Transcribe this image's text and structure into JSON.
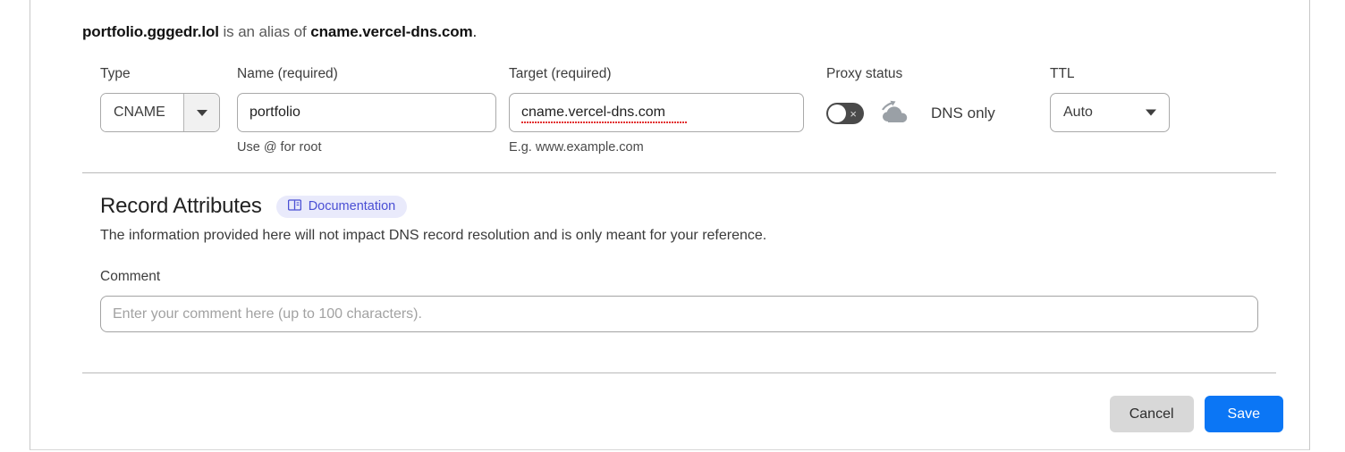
{
  "header": {
    "record_name": "portfolio.gggedr.lol",
    "middle_text": " is an alias of ",
    "target_name": "cname.vercel-dns.com",
    "period": "."
  },
  "form": {
    "type": {
      "label": "Type",
      "value": "CNAME",
      "icon": "chevron-down-icon"
    },
    "name": {
      "label": "Name (required)",
      "value": "portfolio",
      "placeholder": "",
      "hint": "Use @ for root"
    },
    "target": {
      "label": "Target (required)",
      "value": "cname.vercel-dns.com",
      "placeholder": "",
      "hint": "E.g. www.example.com"
    },
    "proxy": {
      "label": "Proxy status",
      "state_text": "DNS only",
      "toggle_state": "off",
      "toggle_mark": "×",
      "cloud_icon": "dns-only-cloud-icon"
    },
    "ttl": {
      "label": "TTL",
      "value": "Auto",
      "icon": "chevron-down-icon"
    }
  },
  "record_attributes": {
    "title": "Record Attributes",
    "badge": {
      "label": "Documentation",
      "icon": "book-icon"
    },
    "description": "The information provided here will not impact DNS record resolution and is only meant for your reference.",
    "comment": {
      "label": "Comment",
      "value": "",
      "placeholder": "Enter your comment here (up to 100 characters)."
    }
  },
  "actions": {
    "cancel_label": "Cancel",
    "save_label": "Save"
  },
  "colors": {
    "save_blue": "#0b76f5",
    "cancel_gray": "#d8d8d8",
    "badge_bg": "#e9eafb",
    "badge_text": "#4a4fd4",
    "toggle_off": "#4a4a4a",
    "cloud_gray": "#9aa0a6"
  }
}
